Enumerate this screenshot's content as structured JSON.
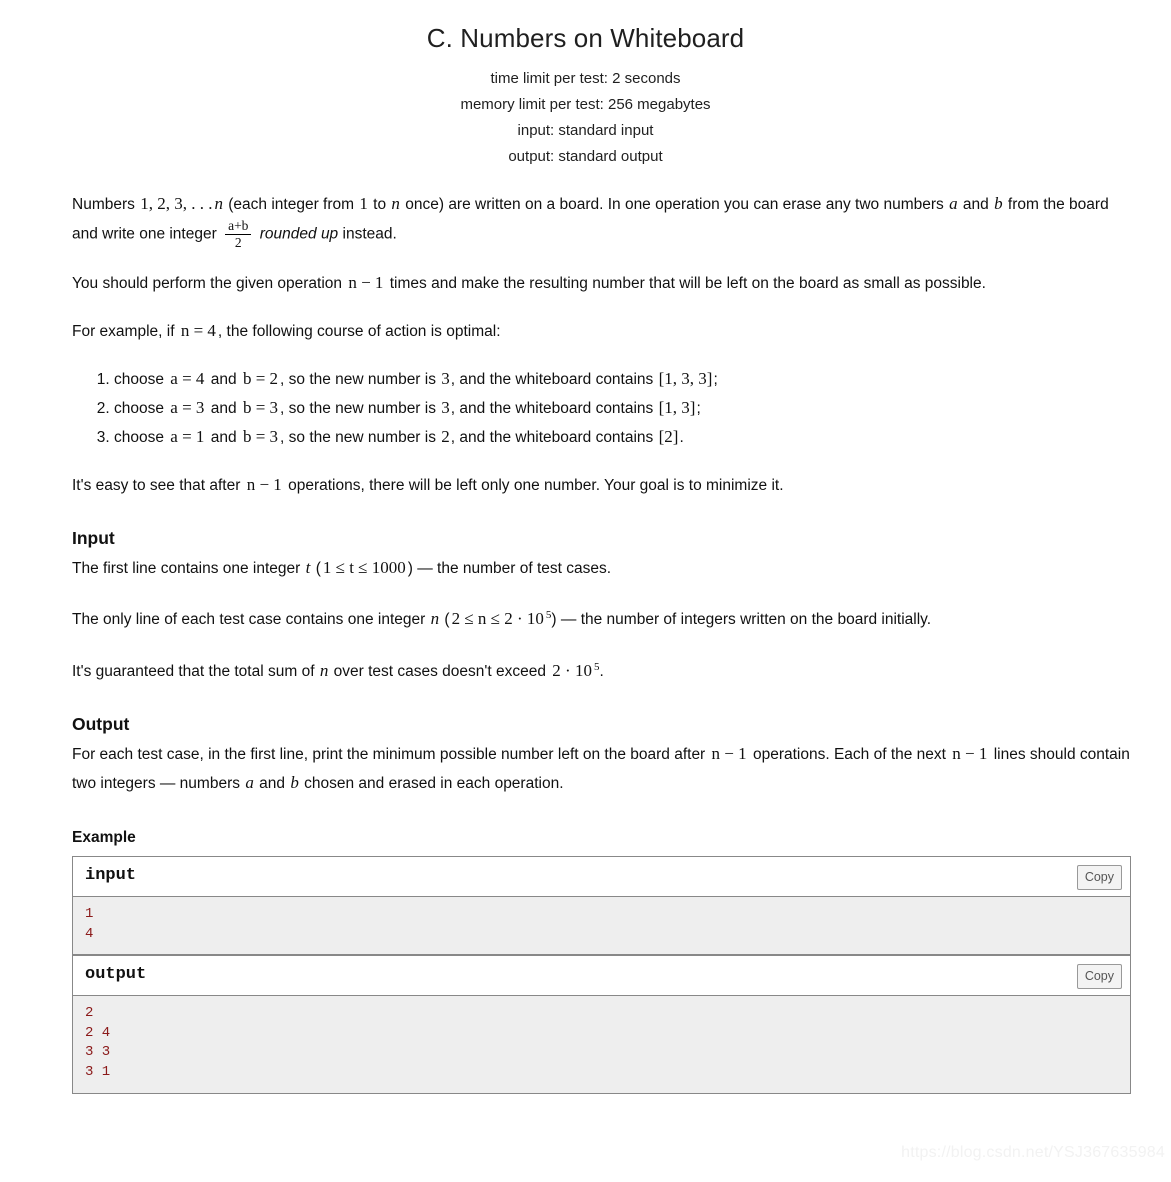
{
  "header": {
    "title": "C. Numbers on Whiteboard",
    "limits": [
      "time limit per test: 2 seconds",
      "memory limit per test: 256 megabytes",
      "input: standard input",
      "output: standard output"
    ]
  },
  "statement": {
    "p1_a": "Numbers",
    "p1_seq": "1, 2, 3, . . .",
    "p1_n1": "n",
    "p1_b": "(each integer from",
    "p1_one": "1",
    "p1_c": "to",
    "p1_n2": "n",
    "p1_d": "once) are written on a board. In one operation you can erase any two numbers",
    "p1_a_var": "a",
    "p1_and": "and",
    "p1_b_var": "b",
    "p1_e": "from the board and write one integer",
    "p1_frac_num": "a+b",
    "p1_frac_den": "2",
    "p1_rounded": "rounded up",
    "p1_f": "instead.",
    "p2_a": "You should perform the given operation",
    "p2_nm1": "n − 1",
    "p2_b": "times and make the resulting number that will be left on the board as small as possible.",
    "p3_a": "For example, if",
    "p3_neq": "n = 4",
    "p3_b": ", the following course of action is optimal:",
    "steps": [
      {
        "pre": "choose",
        "a_eq": "a = 4",
        "and": "and",
        "b_eq": "b = 2",
        "mid": ", so the new number is",
        "result": "3",
        "mid2": ", and the whiteboard contains",
        "board": "[1, 3, 3]",
        "end": ";"
      },
      {
        "pre": "choose",
        "a_eq": "a = 3",
        "and": "and",
        "b_eq": "b = 3",
        "mid": ", so the new number is",
        "result": "3",
        "mid2": ", and the whiteboard contains",
        "board": "[1, 3]",
        "end": ";"
      },
      {
        "pre": "choose",
        "a_eq": "a = 1",
        "and": "and",
        "b_eq": "b = 3",
        "mid": ", so the new number is",
        "result": "2",
        "mid2": ", and the whiteboard contains",
        "board": "[2]",
        "end": "."
      }
    ],
    "p4_a": "It's easy to see that after",
    "p4_nm1": "n − 1",
    "p4_b": "operations, there will be left only one number. Your goal is to minimize it."
  },
  "input_section": {
    "heading": "Input",
    "l1_a": "The first line contains one integer",
    "l1_t": "t",
    "l1_open": "(",
    "l1_range": "1 ≤ t ≤ 1000",
    "l1_close": ")",
    "l1_b": "— the number of test cases.",
    "l2_a": "The only line of each test case contains one integer",
    "l2_n": "n",
    "l2_open": "(",
    "l2_range_a": "2 ≤ n ≤ 2 · 10",
    "l2_range_sup": "5",
    "l2_close": ")",
    "l2_b": "— the number of integers written on the board initially.",
    "l3_a": "It's guaranteed that the total sum of",
    "l3_n": "n",
    "l3_b": "over test cases doesn't exceed",
    "l3_val": "2 · 10",
    "l3_sup": "5",
    "l3_end": "."
  },
  "output_section": {
    "heading": "Output",
    "l1_a": "For each test case, in the first line, print the minimum possible number left on the board after",
    "l1_nm1": "n − 1",
    "l1_b": "operations. Each of the next",
    "l1_nm1b": "n − 1",
    "l1_c": "lines should contain two integers — numbers",
    "l1_a_var": "a",
    "l1_and": "and",
    "l1_b_var": "b",
    "l1_d": "chosen and erased in each operation."
  },
  "example": {
    "heading": "Example",
    "input_label": "input",
    "input_copy_label": "Copy",
    "input_data": "1\n4",
    "output_label": "output",
    "output_copy_label": "Copy",
    "output_data": "2\n2 4\n3 3\n3 1"
  },
  "watermark": "https://blog.csdn.net/YSJ367635984"
}
